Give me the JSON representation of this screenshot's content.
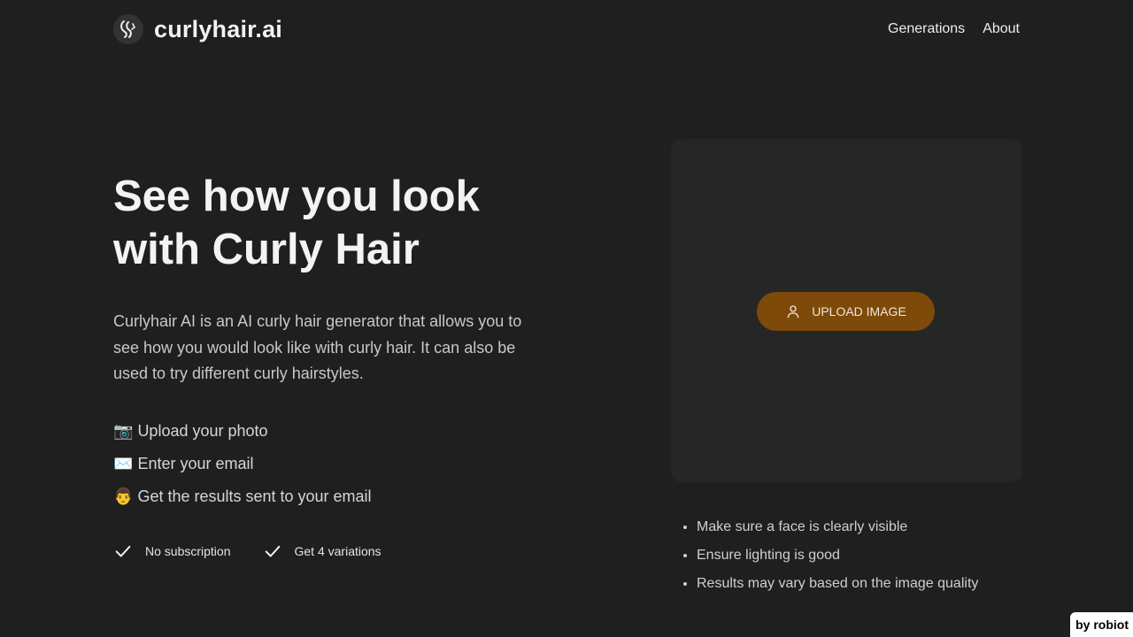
{
  "header": {
    "brand": "curlyhair.ai",
    "logo_icon": "curly-hair-logo-icon",
    "nav": [
      {
        "label": "Generations"
      },
      {
        "label": "About"
      }
    ]
  },
  "hero": {
    "title_line1": "See how you look",
    "title_line2": "with Curly Hair",
    "description": "Curlyhair AI is an AI curly hair generator that allows you to see how you would look like with curly hair. It can also be used to try different curly hairstyles.",
    "steps": [
      {
        "emoji": "📷",
        "text": "Upload your photo"
      },
      {
        "emoji": "✉️",
        "text": "Enter your email"
      },
      {
        "emoji": "👨",
        "text": "Get the results sent to your email"
      }
    ],
    "features": [
      {
        "icon": "check-icon",
        "label": "No subscription"
      },
      {
        "icon": "check-icon",
        "label": "Get 4 variations"
      }
    ]
  },
  "upload": {
    "button_label": "UPLOAD IMAGE",
    "button_icon": "user-icon",
    "button_color": "#7d4a09"
  },
  "tips": [
    "Make sure a face is clearly visible",
    "Ensure lighting is good",
    "Results may vary based on the image quality"
  ],
  "badge": {
    "label": "by robiot"
  }
}
